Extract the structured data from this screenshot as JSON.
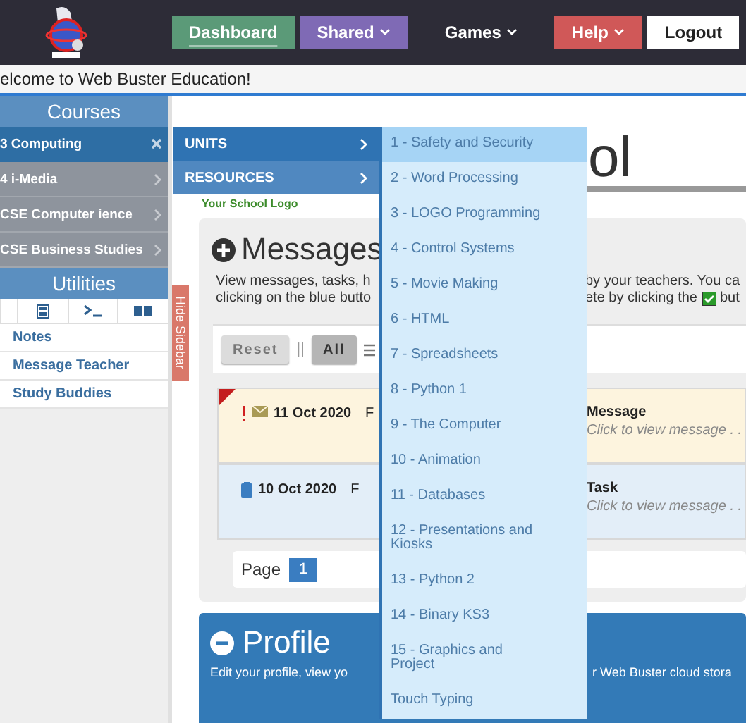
{
  "header": {
    "nav": [
      {
        "label": "Dashboard",
        "kind": "filled",
        "color": "#5b9a78",
        "caret": false,
        "selected": true
      },
      {
        "label": "Shared",
        "kind": "filled",
        "color": "#7f6ab5",
        "caret": true,
        "selected": false
      },
      {
        "label": "Games",
        "kind": "text",
        "caret": true,
        "selected": false
      },
      {
        "label": "Help",
        "kind": "filled",
        "color": "#d05858",
        "caret": true,
        "selected": false
      },
      {
        "label": "Logout",
        "kind": "light",
        "caret": false,
        "selected": false
      }
    ]
  },
  "welcome": "elcome to Web Buster Education!",
  "sidebar": {
    "courses_title": "Courses",
    "courses": [
      {
        "label": "3 Computing",
        "selected": true
      },
      {
        "label": "4 i-Media",
        "selected": false
      },
      {
        "label": "CSE Computer ience",
        "selected": false
      },
      {
        "label": "CSE Business Studies",
        "selected": false
      }
    ],
    "utilities_title": "Utilities",
    "utility_links": [
      "Notes",
      "Message Teacher",
      "Study Buddies"
    ],
    "hide_tab": "Hide Sidebar"
  },
  "submenu": [
    {
      "label": "UNITS",
      "selected": true
    },
    {
      "label": "RESOURCES",
      "selected": false
    }
  ],
  "units": [
    {
      "label": "1 - Safety and Security",
      "selected": true
    },
    {
      "label": "2 - Word Processing",
      "selected": false
    },
    {
      "label": "3 - LOGO Programming",
      "selected": false
    },
    {
      "label": "4 - Control Systems",
      "selected": false
    },
    {
      "label": "5 - Movie Making",
      "selected": false
    },
    {
      "label": "6 - HTML",
      "selected": false
    },
    {
      "label": "7 - Spreadsheets",
      "selected": false
    },
    {
      "label": "8 - Python 1",
      "selected": false
    },
    {
      "label": "9 - The Computer",
      "selected": false
    },
    {
      "label": "10 - Animation",
      "selected": false
    },
    {
      "label": "11 - Databases",
      "selected": false
    },
    {
      "label": "12 - Presentations and Kiosks",
      "selected": false
    },
    {
      "label": "13 - Python 2",
      "selected": false
    },
    {
      "label": "14 - Binary KS3",
      "selected": false
    },
    {
      "label": "15 - Graphics and Project",
      "selected": false
    },
    {
      "label": "Touch Typing",
      "selected": false
    }
  ],
  "page_title": "ol",
  "logo_caption": "Your School Logo",
  "messages": {
    "title": "Messages",
    "description_left": [
      "View messages, tasks, h",
      "clicking on the blue butto"
    ],
    "description_right": [
      "by your teachers. You ca",
      "ete by clicking the",
      "but"
    ],
    "filters": [
      {
        "label": "Reset",
        "selected": false
      },
      {
        "label": "All",
        "selected": true
      }
    ],
    "separator": "||",
    "rows": [
      {
        "kind": "message",
        "urgent": true,
        "date": "11 Oct 2020",
        "from": "F",
        "title": "Message",
        "preview": "Click to view message . ."
      },
      {
        "kind": "task",
        "urgent": false,
        "date": "10 Oct 2020",
        "from": "F",
        "title": "Task",
        "preview": "Click to view message . ."
      }
    ],
    "pagination": {
      "label": "Page",
      "pages": [
        {
          "label": "1",
          "selected": true
        }
      ]
    }
  },
  "profile": {
    "title": "Profile",
    "description_left": "Edit your profile, view yo",
    "description_right": "r Web Buster cloud stora"
  }
}
